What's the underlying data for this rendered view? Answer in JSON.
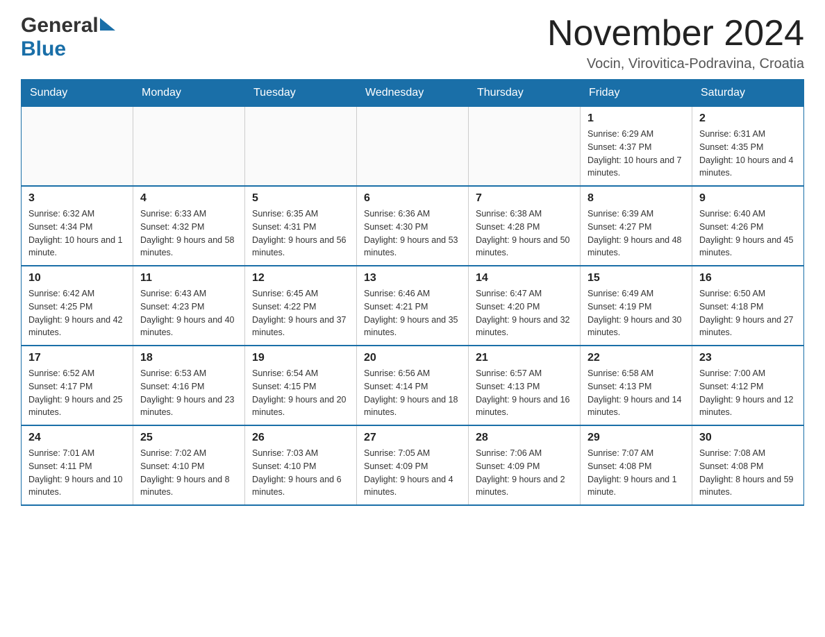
{
  "header": {
    "logo_general": "General",
    "logo_blue": "Blue",
    "month_title": "November 2024",
    "location": "Vocin, Virovitica-Podravina, Croatia"
  },
  "calendar": {
    "days_of_week": [
      "Sunday",
      "Monday",
      "Tuesday",
      "Wednesday",
      "Thursday",
      "Friday",
      "Saturday"
    ],
    "weeks": [
      [
        {
          "day": "",
          "info": ""
        },
        {
          "day": "",
          "info": ""
        },
        {
          "day": "",
          "info": ""
        },
        {
          "day": "",
          "info": ""
        },
        {
          "day": "",
          "info": ""
        },
        {
          "day": "1",
          "info": "Sunrise: 6:29 AM\nSunset: 4:37 PM\nDaylight: 10 hours and 7 minutes."
        },
        {
          "day": "2",
          "info": "Sunrise: 6:31 AM\nSunset: 4:35 PM\nDaylight: 10 hours and 4 minutes."
        }
      ],
      [
        {
          "day": "3",
          "info": "Sunrise: 6:32 AM\nSunset: 4:34 PM\nDaylight: 10 hours and 1 minute."
        },
        {
          "day": "4",
          "info": "Sunrise: 6:33 AM\nSunset: 4:32 PM\nDaylight: 9 hours and 58 minutes."
        },
        {
          "day": "5",
          "info": "Sunrise: 6:35 AM\nSunset: 4:31 PM\nDaylight: 9 hours and 56 minutes."
        },
        {
          "day": "6",
          "info": "Sunrise: 6:36 AM\nSunset: 4:30 PM\nDaylight: 9 hours and 53 minutes."
        },
        {
          "day": "7",
          "info": "Sunrise: 6:38 AM\nSunset: 4:28 PM\nDaylight: 9 hours and 50 minutes."
        },
        {
          "day": "8",
          "info": "Sunrise: 6:39 AM\nSunset: 4:27 PM\nDaylight: 9 hours and 48 minutes."
        },
        {
          "day": "9",
          "info": "Sunrise: 6:40 AM\nSunset: 4:26 PM\nDaylight: 9 hours and 45 minutes."
        }
      ],
      [
        {
          "day": "10",
          "info": "Sunrise: 6:42 AM\nSunset: 4:25 PM\nDaylight: 9 hours and 42 minutes."
        },
        {
          "day": "11",
          "info": "Sunrise: 6:43 AM\nSunset: 4:23 PM\nDaylight: 9 hours and 40 minutes."
        },
        {
          "day": "12",
          "info": "Sunrise: 6:45 AM\nSunset: 4:22 PM\nDaylight: 9 hours and 37 minutes."
        },
        {
          "day": "13",
          "info": "Sunrise: 6:46 AM\nSunset: 4:21 PM\nDaylight: 9 hours and 35 minutes."
        },
        {
          "day": "14",
          "info": "Sunrise: 6:47 AM\nSunset: 4:20 PM\nDaylight: 9 hours and 32 minutes."
        },
        {
          "day": "15",
          "info": "Sunrise: 6:49 AM\nSunset: 4:19 PM\nDaylight: 9 hours and 30 minutes."
        },
        {
          "day": "16",
          "info": "Sunrise: 6:50 AM\nSunset: 4:18 PM\nDaylight: 9 hours and 27 minutes."
        }
      ],
      [
        {
          "day": "17",
          "info": "Sunrise: 6:52 AM\nSunset: 4:17 PM\nDaylight: 9 hours and 25 minutes."
        },
        {
          "day": "18",
          "info": "Sunrise: 6:53 AM\nSunset: 4:16 PM\nDaylight: 9 hours and 23 minutes."
        },
        {
          "day": "19",
          "info": "Sunrise: 6:54 AM\nSunset: 4:15 PM\nDaylight: 9 hours and 20 minutes."
        },
        {
          "day": "20",
          "info": "Sunrise: 6:56 AM\nSunset: 4:14 PM\nDaylight: 9 hours and 18 minutes."
        },
        {
          "day": "21",
          "info": "Sunrise: 6:57 AM\nSunset: 4:13 PM\nDaylight: 9 hours and 16 minutes."
        },
        {
          "day": "22",
          "info": "Sunrise: 6:58 AM\nSunset: 4:13 PM\nDaylight: 9 hours and 14 minutes."
        },
        {
          "day": "23",
          "info": "Sunrise: 7:00 AM\nSunset: 4:12 PM\nDaylight: 9 hours and 12 minutes."
        }
      ],
      [
        {
          "day": "24",
          "info": "Sunrise: 7:01 AM\nSunset: 4:11 PM\nDaylight: 9 hours and 10 minutes."
        },
        {
          "day": "25",
          "info": "Sunrise: 7:02 AM\nSunset: 4:10 PM\nDaylight: 9 hours and 8 minutes."
        },
        {
          "day": "26",
          "info": "Sunrise: 7:03 AM\nSunset: 4:10 PM\nDaylight: 9 hours and 6 minutes."
        },
        {
          "day": "27",
          "info": "Sunrise: 7:05 AM\nSunset: 4:09 PM\nDaylight: 9 hours and 4 minutes."
        },
        {
          "day": "28",
          "info": "Sunrise: 7:06 AM\nSunset: 4:09 PM\nDaylight: 9 hours and 2 minutes."
        },
        {
          "day": "29",
          "info": "Sunrise: 7:07 AM\nSunset: 4:08 PM\nDaylight: 9 hours and 1 minute."
        },
        {
          "day": "30",
          "info": "Sunrise: 7:08 AM\nSunset: 4:08 PM\nDaylight: 8 hours and 59 minutes."
        }
      ]
    ]
  }
}
